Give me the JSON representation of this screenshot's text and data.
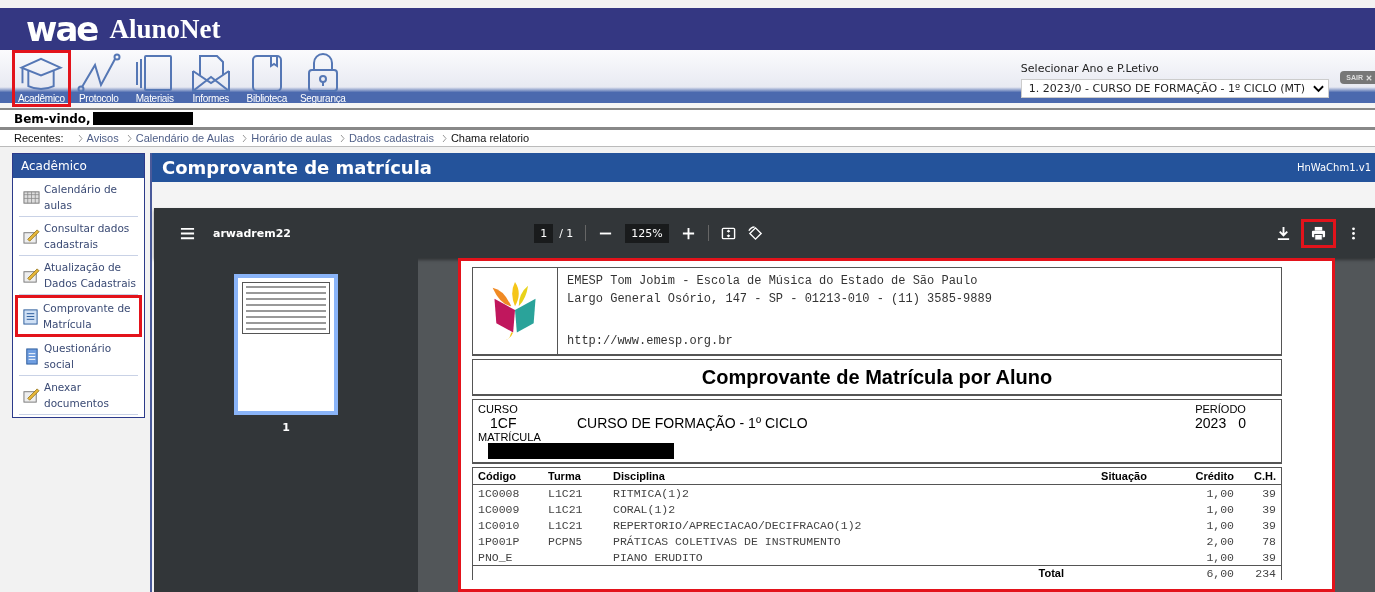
{
  "header": {
    "logo": "wae",
    "title": "AlunoNet"
  },
  "nav": [
    {
      "label": "Acadêmico",
      "kind": "cap",
      "highlighted": true
    },
    {
      "label": "Protocolo",
      "kind": "chart",
      "highlighted": false
    },
    {
      "label": "Materiais",
      "kind": "pages",
      "highlighted": false
    },
    {
      "label": "Informes",
      "kind": "envelope",
      "highlighted": false
    },
    {
      "label": "Biblioteca",
      "kind": "book",
      "highlighted": false
    },
    {
      "label": "Segurança",
      "kind": "lock",
      "highlighted": false
    }
  ],
  "period_selector": {
    "label": "Selecionar Ano e P.Letivo",
    "value": "1. 2023/0 - CURSO DE FORMAÇÃO - 1º CICLO (MT)"
  },
  "logout_button": "SAIR",
  "welcome": "Bem-vindo,",
  "breadcrumb": {
    "label": "Recentes:",
    "items": [
      {
        "label": "Avisos",
        "current": false
      },
      {
        "label": "Calendário de Aulas",
        "current": false
      },
      {
        "label": "Horário de aulas",
        "current": false
      },
      {
        "label": "Dados cadastrais",
        "current": false
      },
      {
        "label": "Chama relatorio",
        "current": true
      }
    ]
  },
  "sidebar": {
    "title": "Acadêmico",
    "items": [
      {
        "label": "Calendário de aulas",
        "kind": "calendar",
        "highlighted": false
      },
      {
        "label": "Consultar dados cadastrais",
        "kind": "edit",
        "highlighted": false
      },
      {
        "label": "Atualização de Dados Cadastrais",
        "kind": "edit",
        "highlighted": false
      },
      {
        "label": "Comprovante de Matrícula",
        "kind": "report",
        "highlighted": true
      },
      {
        "label": "Questionário social",
        "kind": "sheet",
        "highlighted": false
      },
      {
        "label": "Anexar documentos",
        "kind": "edit",
        "highlighted": false
      }
    ]
  },
  "page": {
    "title": "Comprovante de matrícula",
    "code": "HnWaChm1.v1"
  },
  "pdf_viewer": {
    "filename": "arwadrem22",
    "page_input": "1",
    "page_total": "/ 1",
    "zoom": "125%",
    "print_highlighted": true,
    "thumbnails": [
      {
        "label": "1",
        "selected": true
      }
    ]
  },
  "document": {
    "highlighted": true,
    "institution": [
      "EMESP Tom Jobim - Escola de Música do Estado de São Paulo",
      "Largo General Osório, 147 - SP - 01213-010 - (11) 3585-9889"
    ],
    "url": "http://www.emesp.org.br",
    "title": "Comprovante de Matrícula por Aluno",
    "course_label": "CURSO",
    "course_code": "1CF",
    "course_name": "CURSO DE FORMAÇÃO - 1º CICLO",
    "period_label": "PERÍODO",
    "period_year": "2023",
    "period_number": "0",
    "matricula_label": "MATRÍCULA",
    "table": {
      "columns": [
        "Código",
        "Turma",
        "Disciplina",
        "Situação",
        "Crédito",
        "C.H."
      ],
      "rows": [
        [
          "1C0008",
          "L1C21",
          "RITMICA(1)2",
          "",
          "1,00",
          "39"
        ],
        [
          "1C0009",
          "L1C21",
          "CORAL(1)2",
          "",
          "1,00",
          "39"
        ],
        [
          "1C0010",
          "L1C21",
          "REPERTORIO/APRECIACAO/DECIFRACAO(1)2",
          "",
          "1,00",
          "39"
        ],
        [
          "1P001P",
          "PCPN5",
          "PRÁTICAS COLETIVAS DE INSTRUMENTO",
          "",
          "2,00",
          "78"
        ],
        [
          "PNO_E",
          "",
          "PIANO ERUDITO",
          "",
          "1,00",
          "39"
        ]
      ]
    },
    "total_label": "Total",
    "total_credit": "6,00",
    "total_hours": "234"
  }
}
